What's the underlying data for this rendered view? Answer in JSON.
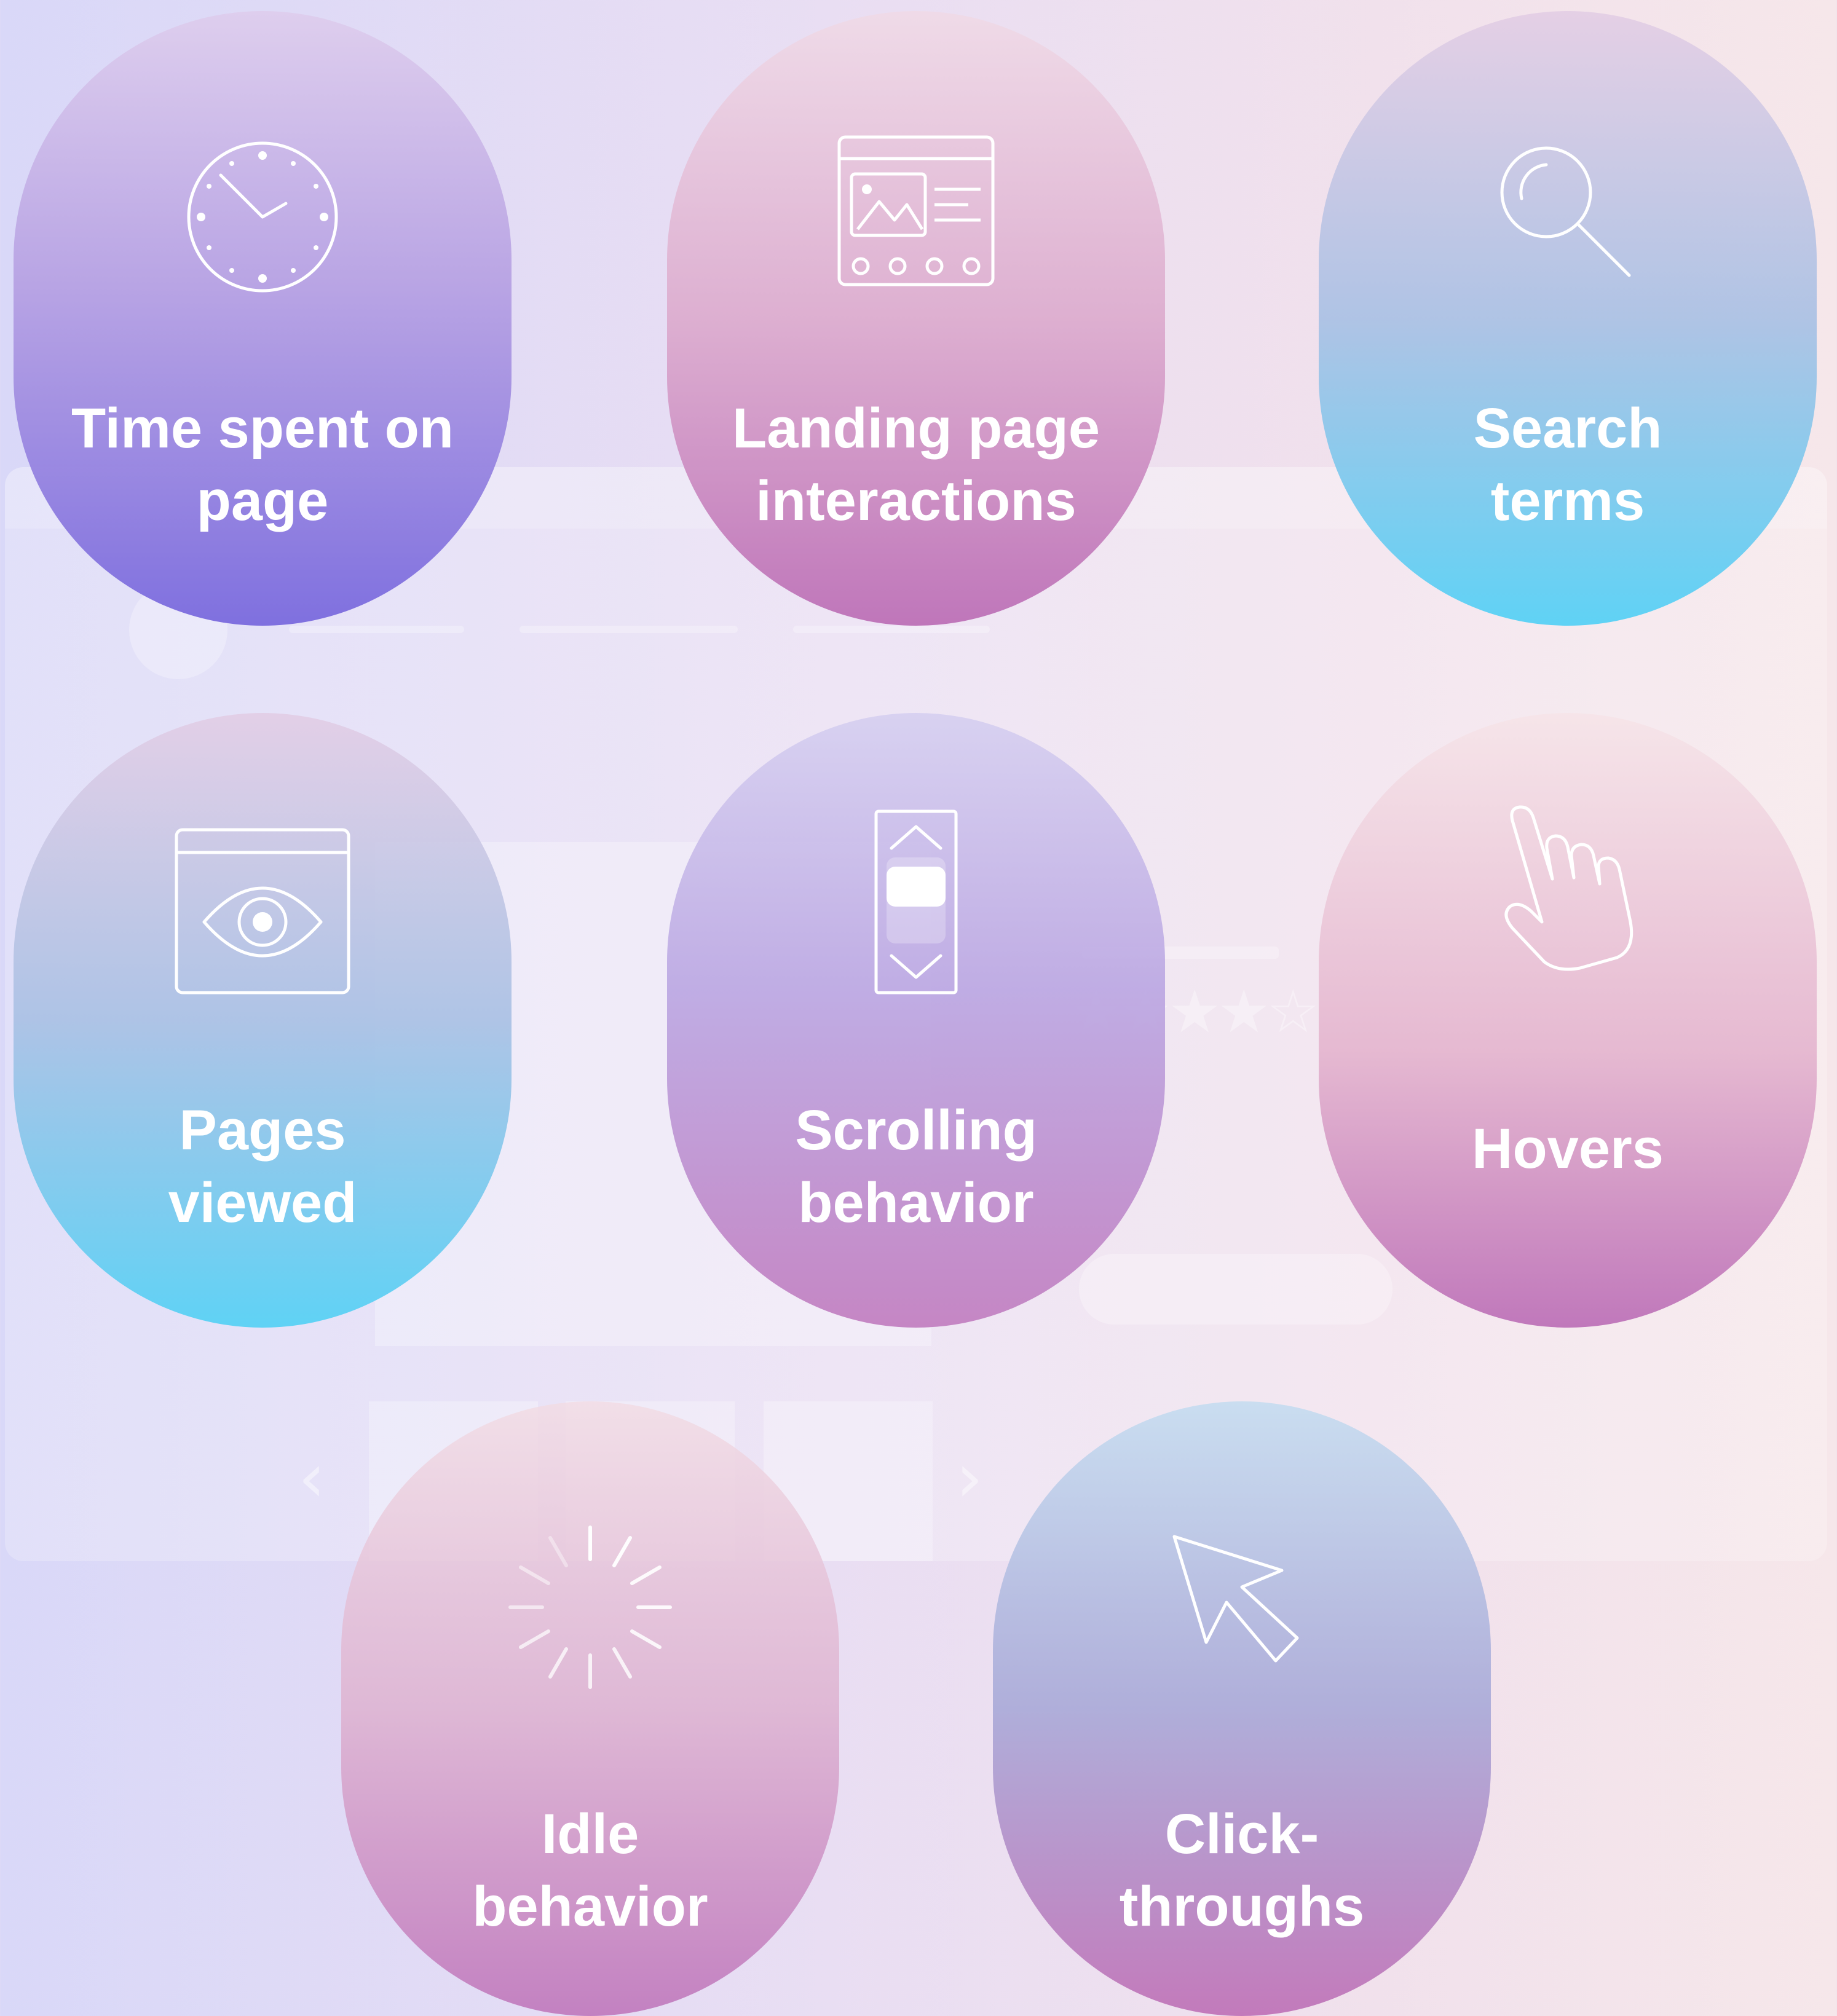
{
  "cards": [
    {
      "label": "Time spent on\npage",
      "icon": "clock-icon"
    },
    {
      "label": "Landing page\ninteractions",
      "icon": "landing-page-icon"
    },
    {
      "label": "Search\nterms",
      "icon": "magnifier-icon"
    },
    {
      "label": "Pages\nviewed",
      "icon": "browser-eye-icon"
    },
    {
      "label": "Scrolling\nbehavior",
      "icon": "scrollbar-icon"
    },
    {
      "label": "Hovers",
      "icon": "pointing-hand-icon"
    },
    {
      "label": "Idle\nbehavior",
      "icon": "loading-spinner-icon"
    },
    {
      "label": "Click-\nthroughs",
      "icon": "mouse-cursor-icon"
    }
  ],
  "colors": {
    "card_purple": "#7f70df",
    "card_pink": "#bf76ba",
    "card_blue": "#5fd2f5",
    "text": "#ffffff"
  }
}
